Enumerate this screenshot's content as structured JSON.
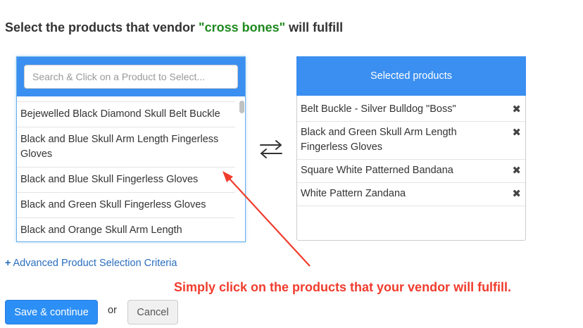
{
  "heading": {
    "prefix": "Select the products that vendor ",
    "vendor_name": "\"cross bones\"",
    "suffix": " will fulfill"
  },
  "search": {
    "placeholder": "Search & Click on a Product to Select..."
  },
  "available_products": [
    "Bejewelled Black Diamond Skull Belt Buckle",
    "Black and Blue Skull Arm Length Fingerless Gloves",
    "Black and Blue Skull Fingerless Gloves",
    "Black and Green Skull Fingerless Gloves",
    "Black and Orange Skull Arm Length"
  ],
  "selected_panel": {
    "title": "Selected products",
    "items": [
      "Belt Buckle - Silver Bulldog \"Boss\"",
      "Black and Green Skull Arm Length Fingerless Gloves",
      "Square White Patterned Bandana",
      "White Pattern Zandana"
    ],
    "remove_glyph": "✖"
  },
  "swap_icon": "swap-arrows-icon",
  "advanced_link": {
    "plus": "+",
    "label": "Advanced Product Selection Criteria"
  },
  "annotation": {
    "text": "Simply click on the products that your vendor will fulfill.",
    "color": "#f03c2d"
  },
  "buttons": {
    "save": "Save & continue",
    "or": "or",
    "cancel": "Cancel"
  },
  "colors": {
    "accent": "#3b8ff0",
    "vendor": "#1f8a1f",
    "link": "#2a6fbf"
  }
}
